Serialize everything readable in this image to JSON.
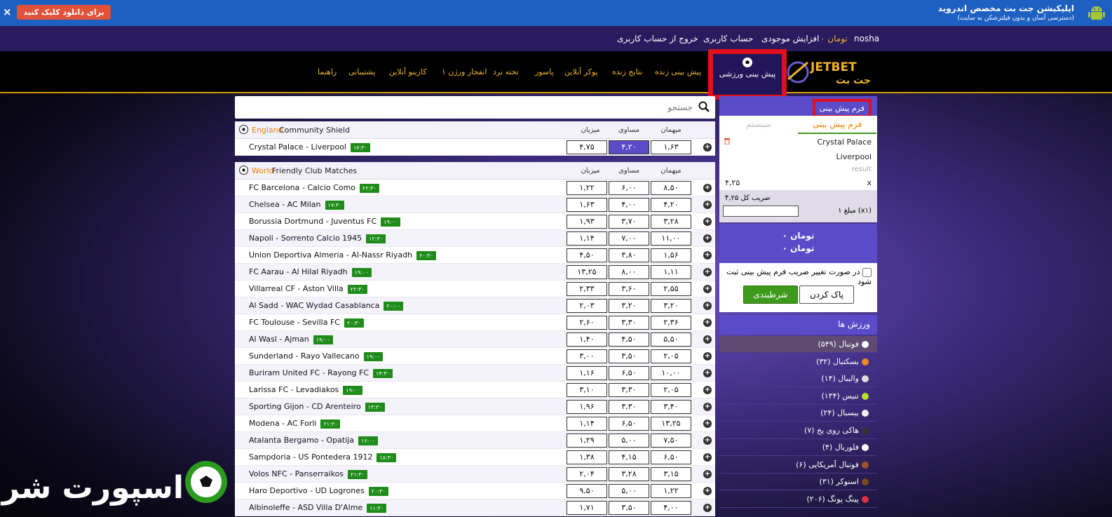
{
  "banner": {
    "close": "×",
    "download": "برای دانلود کلیک کنید",
    "title": "اپلیکیشن جت بت مخصص اندروید",
    "subtitle": "(دسترسی آسان و بدون فیلترشکن به سایت)"
  },
  "user": {
    "name": "nosha",
    "balance": "تومان ۰",
    "deposit": "افزایش موجودی",
    "account": "حساب کاربری",
    "logout": "خروج از حساب کاربری"
  },
  "logo": {
    "en": "JETBET",
    "fa": "جت بت"
  },
  "nav": {
    "sport": "پیش بینی ورزشی",
    "items": [
      "پیش بینی زنده",
      "نتایج زنده",
      "پوکر آنلاین",
      "پاسور",
      "تخته نرد",
      "انفجار ورژن ۱",
      "کازینو آنلاین",
      "پشتیبانی",
      "راهنما"
    ]
  },
  "search": {
    "placeholder": "جستجو"
  },
  "odds_headers": {
    "home": "میهمان",
    "draw": "مساوی",
    "away": "میزبان"
  },
  "leagues": [
    {
      "country": "England",
      "name": "Community Shield",
      "matches": [
        {
          "teams": "Crystal Palace - Liverpool",
          "time": "۱۷:۳۰",
          "odds": [
            "۱,۶۳",
            "۴,۲۰",
            "۴,۷۵"
          ],
          "selected": 1
        }
      ]
    },
    {
      "country": "World",
      "name": "Friendly Club Matches",
      "matches": [
        {
          "teams": "FC Barcelona - Calcio Como",
          "time": "۲۲:۳۰",
          "odds": [
            "۸,۵۰",
            "۶,۰۰",
            "۱,۲۲"
          ]
        },
        {
          "teams": "Chelsea - AC Milan",
          "time": "۱۷:۳۰",
          "odds": [
            "۴,۲۰",
            "۴,۰۰",
            "۱,۶۳"
          ]
        },
        {
          "teams": "Borussia Dortmund - Juventus FC",
          "time": "۱۹:۰۰",
          "odds": [
            "۳,۲۸",
            "۳,۷۰",
            "۱,۹۳"
          ]
        },
        {
          "teams": "Napoli - Sorrento Calcio 1945",
          "time": "۱۲:۳۰",
          "odds": [
            "۱۱,۰۰",
            "۷,۰۰",
            "۱,۱۴"
          ]
        },
        {
          "teams": "Union Deportiva Almeria - Al-Nassr Riyadh",
          "time": "۲۰:۳۰",
          "odds": [
            "۱,۵۶",
            "۳,۸۰",
            "۴,۵۰"
          ]
        },
        {
          "teams": "FC Aarau - Al Hilal Riyadh",
          "time": "۱۹:۰۰",
          "odds": [
            "۱,۱۱",
            "۸,۰۰",
            "۱۳,۲۵"
          ]
        },
        {
          "teams": "Villarreal CF - Aston Villa",
          "time": "۲۲:۳۰",
          "odds": [
            "۲,۵۵",
            "۳,۶۰",
            "۲,۳۳"
          ]
        },
        {
          "teams": "Al Sadd - WAC Wydad Casablanca",
          "time": "۲۰:۰۰",
          "odds": [
            "۳,۲۰",
            "۳,۲۰",
            "۲,۰۳"
          ]
        },
        {
          "teams": "FC Toulouse - Sevilla FC",
          "time": "۲۰:۳۰",
          "odds": [
            "۲,۳۶",
            "۳,۳۰",
            "۲,۶۰"
          ]
        },
        {
          "teams": "Al Wasl - Ajman",
          "time": "۱۹:۰۰",
          "odds": [
            "۵,۵۰",
            "۴,۵۰",
            "۱,۴۰"
          ]
        },
        {
          "teams": "Sunderland - Rayo Vallecano",
          "time": "۱۹:۰۰",
          "odds": [
            "۲,۰۵",
            "۳,۵۰",
            "۳,۰۰"
          ]
        },
        {
          "teams": "Buriram United FC - Rayong FC",
          "time": "۱۴:۳۰",
          "odds": [
            "۱۰,۰۰",
            "۶,۵۰",
            "۱,۱۶"
          ]
        },
        {
          "teams": "Larissa FC - Levadiakos",
          "time": "۱۹:۰۰",
          "odds": [
            "۲,۰۵",
            "۳,۳۰",
            "۳,۱۰"
          ]
        },
        {
          "teams": "Sporting Gijon - CD Arenteiro",
          "time": "۱۳:۳۰",
          "odds": [
            "۳,۴۰",
            "۳,۳۰",
            "۱,۹۶"
          ]
        },
        {
          "teams": "Modena - AC Forli",
          "time": "۲۱:۳۰",
          "odds": [
            "۱۳,۲۵",
            "۶,۵۰",
            "۱,۱۴"
          ]
        },
        {
          "teams": "Atalanta Bergamo - Opatija",
          "time": "۱۶:۰۰",
          "odds": [
            "۷,۵۰",
            "۵,۰۰",
            "۱,۲۹"
          ]
        },
        {
          "teams": "Sampdoria - US Pontedera 1912",
          "time": "۱۸:۳۰",
          "odds": [
            "۶,۵۰",
            "۴,۱۵",
            "۱,۳۸"
          ]
        },
        {
          "teams": "Volos NFC - Panserraikos",
          "time": "۲۱:۳۰",
          "odds": [
            "۳,۱۵",
            "۳,۲۸",
            "۲,۰۴"
          ]
        },
        {
          "teams": "Haro Deportivo - UD Logrones",
          "time": "۲۰:۳۰",
          "odds": [
            "۱,۲۲",
            "۵,۰۰",
            "۹,۵۰"
          ]
        },
        {
          "teams": "Albinoleffe - ASD Villa D'Alme",
          "time": "۱۱:۳۰",
          "odds": [
            "۴,۰۰",
            "۳,۵۰",
            "۱,۷۱"
          ]
        }
      ]
    }
  ],
  "slip": {
    "title": "فرم پیش بینی",
    "tab_active": "فرم پیش بینی",
    "tab_system": "سیستم",
    "home": "Crystal Palace",
    "away": "Liverpool",
    "result": "result",
    "pick": "x",
    "odd": "۴,۲۵",
    "total_label": "ضریب کل ۴,۲۵",
    "stake_label": "۱ مبلغ (x۱)",
    "sum1": "تومان ۰",
    "sum2": "تومان ۰",
    "checkbox": "در صورت تغییر ضریب فرم پیش بینی ثبت شود",
    "clear": "پاک کردن",
    "bet": "شرطبندی"
  },
  "sports": {
    "title": "ورزش ها",
    "items": [
      {
        "label": "فوتبال (۵۴۹)",
        "color": "#ffffff"
      },
      {
        "label": "بسکتبال (۳۲)",
        "color": "#f08a24"
      },
      {
        "label": "والیبال (۱۴)",
        "color": "#dddddd"
      },
      {
        "label": "تنیس (۱۳۴)",
        "color": "#b5e02a"
      },
      {
        "label": "بیسبال (۲۴)",
        "color": "#eeeeee"
      },
      {
        "label": "هاکی روی یخ (۷)",
        "color": "#333333"
      },
      {
        "label": "فلوربال (۴)",
        "color": "#ffffff"
      },
      {
        "label": "فوتبال آمریکایی (۶)",
        "color": "#a0522d"
      },
      {
        "label": "اسنوکر (۳۱)",
        "color": "#7a4a1a"
      },
      {
        "label": "پینگ پونگ (۲۰۶)",
        "color": "#e03040"
      }
    ]
  },
  "watermark": "اسپورت شرط"
}
